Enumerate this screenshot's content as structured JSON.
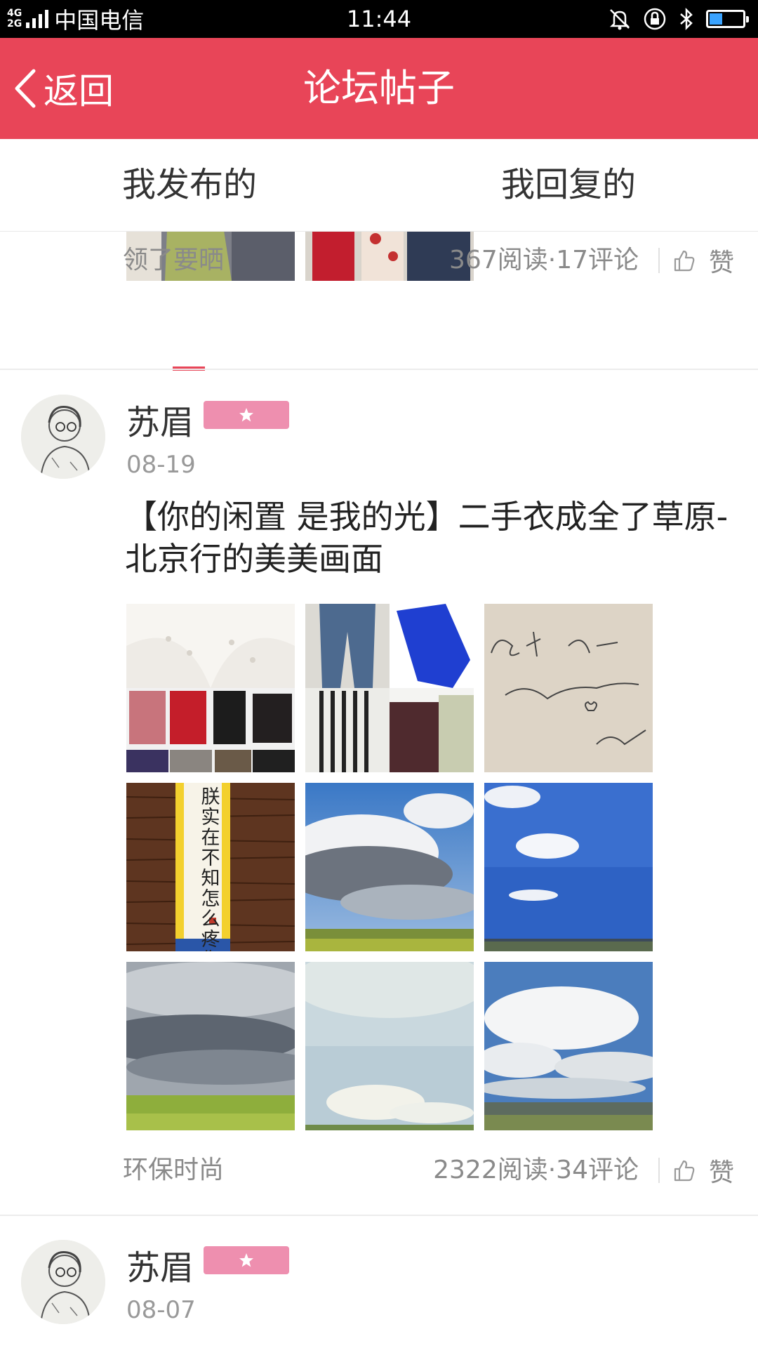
{
  "status_bar": {
    "network_top": "4G",
    "network_bottom": "2G",
    "carrier": "中国电信",
    "time": "11:44",
    "battery_level": 0.4
  },
  "header": {
    "back_label": "返回",
    "title": "论坛帖子"
  },
  "tabs": [
    {
      "label": "我发布的",
      "active": true
    },
    {
      "label": "我回复的",
      "active": false
    }
  ],
  "posts": [
    {
      "tag": "领了要晒",
      "stats": "367阅读·17评论",
      "like_label": "赞"
    },
    {
      "author": "苏眉",
      "date": "08-19",
      "title": "【你的闲置 是我的光】二手衣成全了草原-北京行的美美画面",
      "tag": "环保时尚",
      "stats": "2322阅读·34评论",
      "like_label": "赞",
      "calligraphy_text": "朕实在不知怎么疼你"
    },
    {
      "author": "苏眉",
      "date": "08-07"
    }
  ],
  "icons": {
    "back": "chevron-left-icon",
    "like": "thumbs-up-icon",
    "badge": "star-icon",
    "silent": "bell-off-icon",
    "lock": "rotation-lock-icon",
    "bluetooth": "bluetooth-icon"
  },
  "colors": {
    "accent": "#e84558",
    "badge": "#ee8faf",
    "muted_text": "#8a8a8a"
  }
}
